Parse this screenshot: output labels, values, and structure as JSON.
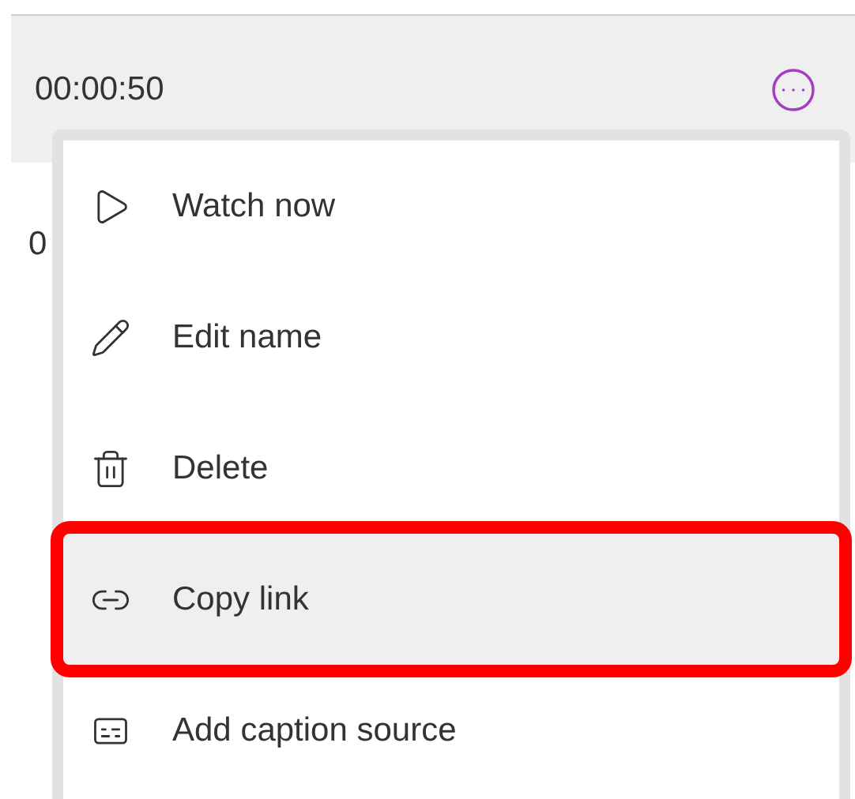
{
  "row": {
    "duration": "00:00:50"
  },
  "next_row": {
    "duration": "0"
  },
  "menu": {
    "items": [
      {
        "kind": "play",
        "label": "Watch now",
        "highlighted": false
      },
      {
        "kind": "edit",
        "label": "Edit name",
        "highlighted": false
      },
      {
        "kind": "delete",
        "label": "Delete",
        "highlighted": false
      },
      {
        "kind": "link",
        "label": "Copy link",
        "highlighted": true
      },
      {
        "kind": "captions",
        "label": "Add caption source",
        "highlighted": false
      }
    ]
  }
}
